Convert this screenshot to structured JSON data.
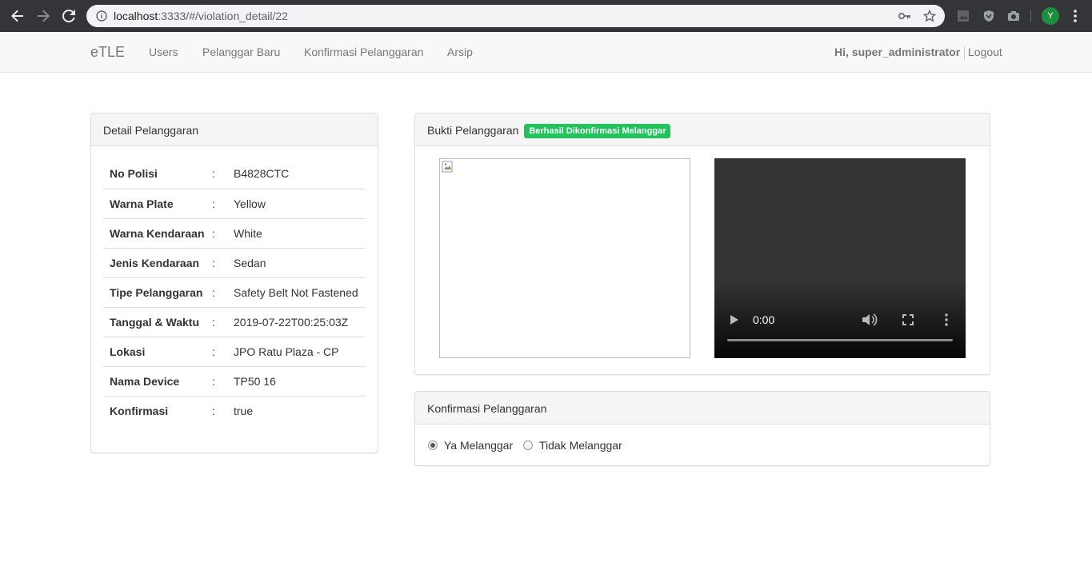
{
  "browser": {
    "url_host": "localhost",
    "url_rest": ":3333/#/violation_detail/22",
    "profile_initial": "Y"
  },
  "navbar": {
    "brand": "eTLE",
    "links": [
      "Users",
      "Pelanggar Baru",
      "Konfirmasi Pelanggaran",
      "Arsip"
    ],
    "greeting": "Hi, super_administrator",
    "logout": "Logout"
  },
  "detail": {
    "title": "Detail Pelanggaran",
    "separator": ":",
    "rows": [
      {
        "label": "No Polisi",
        "value": "B4828CTC"
      },
      {
        "label": "Warna Plate",
        "value": "Yellow"
      },
      {
        "label": "Warna Kendaraan",
        "value": "White"
      },
      {
        "label": "Jenis Kendaraan",
        "value": "Sedan"
      },
      {
        "label": "Tipe Pelanggaran",
        "value": "Safety Belt Not Fastened"
      },
      {
        "label": "Tanggal & Waktu",
        "value": "2019-07-22T00:25:03Z"
      },
      {
        "label": "Lokasi",
        "value": "JPO Ratu Plaza - CP"
      },
      {
        "label": "Nama Device",
        "value": "TP50 16"
      },
      {
        "label": "Konfirmasi",
        "value": "true"
      }
    ]
  },
  "evidence": {
    "title": "Bukti Pelanggaran",
    "status_badge": "Berhasil Dikonfirmasi Melanggar",
    "badge_color": "#1fc45a",
    "video_time": "0:00"
  },
  "confirmation": {
    "title": "Konfirmasi Pelanggaran",
    "options": [
      {
        "label": "Ya Melanggar",
        "selected": true
      },
      {
        "label": "Tidak Melanggar",
        "selected": false
      }
    ]
  }
}
